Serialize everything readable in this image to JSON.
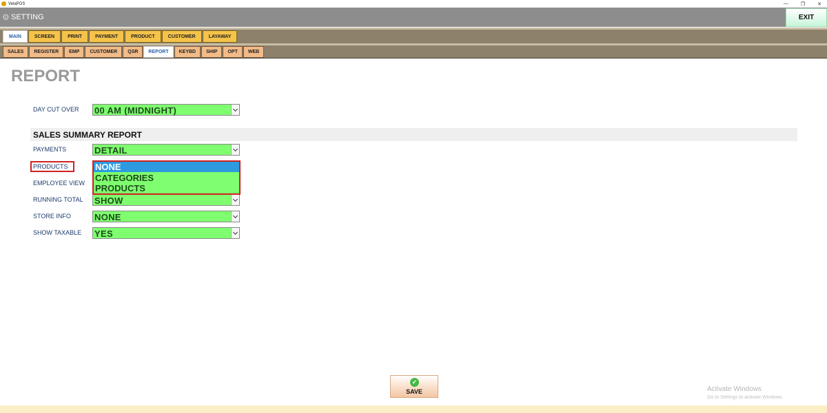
{
  "window": {
    "title": "VelaPOS",
    "controls": [
      "—",
      "❐",
      "✕"
    ]
  },
  "header": {
    "title": "SETTING",
    "exit_label": "EXIT"
  },
  "main_tabs": [
    "MAIN",
    "SCREEN",
    "PRINT",
    "PAYMENT",
    "PRODUCT",
    "CUSTOMER",
    "LAYAWAY"
  ],
  "sub_tabs": [
    "SALES",
    "REGISTER",
    "EMP",
    "CUSTOMER",
    "QSR",
    "REPORT",
    "KEYBD",
    "SHIP",
    "OPT",
    "WEB"
  ],
  "page": {
    "title": "REPORT"
  },
  "day_cut_over": {
    "label": "DAY CUT OVER",
    "value": "00 AM (MIDNIGHT)"
  },
  "section": {
    "title": "SALES SUMMARY REPORT"
  },
  "fields": [
    {
      "label": "PAYMENTS",
      "value": "DETAIL"
    },
    {
      "label": "PRODUCTS",
      "value": "NONE"
    },
    {
      "label": "EMPLOYEE VIEW",
      "value": ""
    },
    {
      "label": "RUNNING TOTAL",
      "value": "SHOW"
    },
    {
      "label": "STORE INFO",
      "value": "NONE"
    },
    {
      "label": "SHOW TAXABLE",
      "value": "YES"
    }
  ],
  "products_dropdown": {
    "options": [
      "NONE",
      "CATEGORIES",
      "PRODUCTS"
    ],
    "selected": "NONE"
  },
  "save": {
    "label": "SAVE"
  },
  "watermark": {
    "title": "Activate Windows",
    "subtitle": "Go to Settings to activate Windows."
  }
}
